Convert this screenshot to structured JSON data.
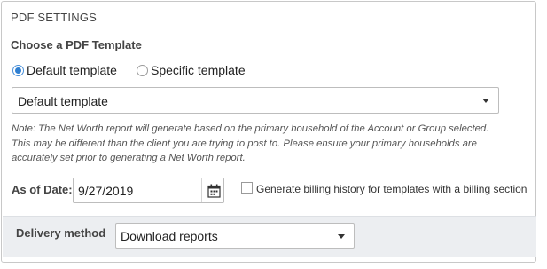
{
  "section": {
    "title": "PDF SETTINGS"
  },
  "template": {
    "label": "Choose a PDF Template",
    "options": [
      {
        "label": "Default template",
        "checked": true
      },
      {
        "label": "Specific template",
        "checked": false
      }
    ],
    "select_value": "Default template"
  },
  "note": {
    "lines": [
      "Note: The Net Worth report will generate based on the primary household of the Account or Group selected.",
      "This may be different than the client you are trying to post to. Please ensure your primary households are",
      "accurately set prior to generating a Net Worth report."
    ]
  },
  "as_of": {
    "label": "As of Date:",
    "value": "9/27/2019",
    "icon": "calendar-icon"
  },
  "billing": {
    "label": "Generate billing history for templates with a billing section",
    "checked": false
  },
  "delivery": {
    "label": "Delivery method",
    "value": "Download reports"
  },
  "colors": {
    "accent": "#2f7fd1",
    "border": "#bdbdbd",
    "delivery_bg": "#eceef1"
  }
}
